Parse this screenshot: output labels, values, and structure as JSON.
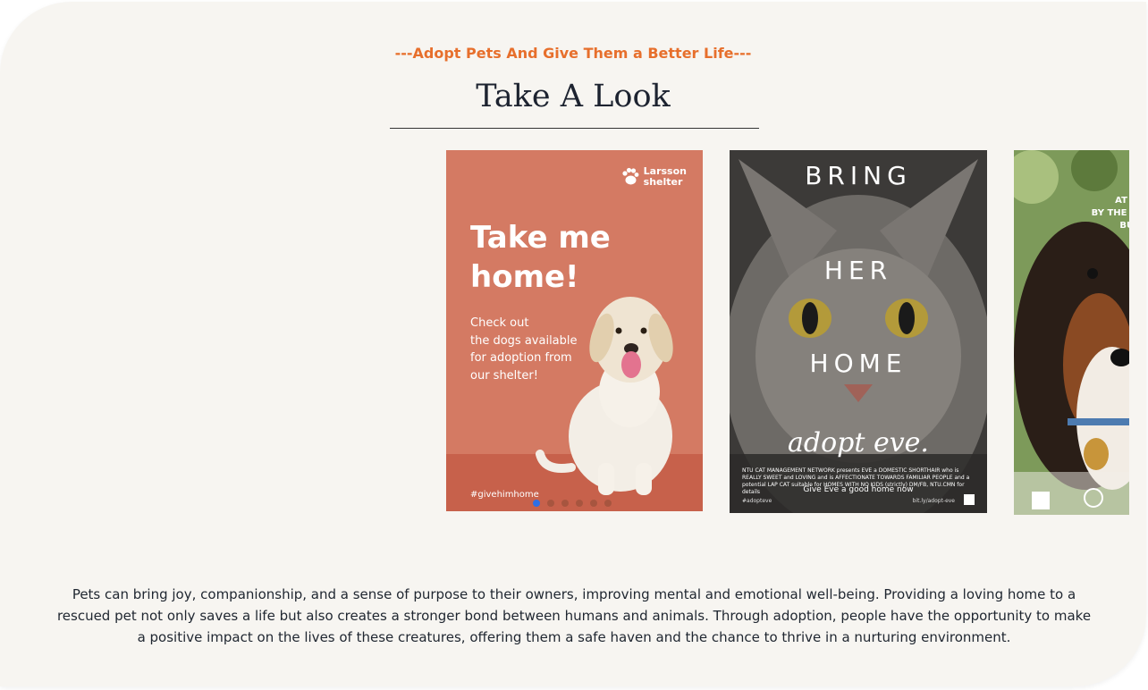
{
  "section": {
    "eyebrow": "---Adopt Pets And Give Them a Better Life---",
    "title": "Take A Look"
  },
  "carousel": {
    "cards": [
      {
        "brand": "Larsson\nshelter",
        "headline": "Take me\nhome!",
        "body": "Check out\nthe dogs available\nfor adoption from\nour shelter!",
        "tag": "#givehimhome",
        "icon": "paw-icon"
      },
      {
        "word1": "BRING",
        "word2": "HER",
        "word3": "HOME",
        "word4": "adopt eve.",
        "fine_print": "NTU CAT MANAGEMENT NETWORK presents EVE a DOMESTIC SHORTHAIR who is REALLY SWEET and LOVING and is AFFECTIONATE TOWARDS FAMILIAR PEOPLE and a potential LAP CAT suitable for HOMES WITH NO KIDS (strictly) DM/FB, NTU.CMN for details",
        "cta": "Give Eve a good home now",
        "footer_left": "#adopteve",
        "footer_right": "bit.ly/adopt-eve"
      },
      {
        "text": "AT FI\nBY THE W\nBUT\n\nIS"
      }
    ],
    "dots": {
      "count": 6,
      "active_index": 0
    },
    "accent_active": "#2f6fe4"
  },
  "description": "Pets can bring joy, companionship, and a sense of purpose to their owners, improving mental and emotional well-being. Providing a loving home to a rescued pet not only saves a life but also creates a stronger bond between humans and animals. Through adoption, people have the opportunity to make a positive impact on the lives of these creatures, offering them a safe haven and the chance to thrive in a nurturing environment.",
  "colors": {
    "eyebrow": "#e76f2c",
    "background": "#f7f5f1",
    "poster1": "#d47a63"
  }
}
